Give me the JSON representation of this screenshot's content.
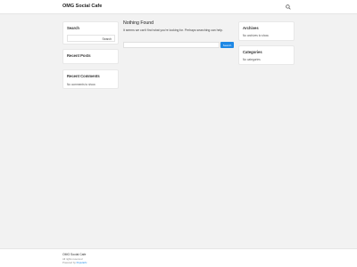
{
  "header": {
    "site_title": "OMG Social Cafe",
    "search_icon": "search-icon"
  },
  "sidebar_left": {
    "search": {
      "title": "Search",
      "button_label": "Search"
    },
    "recent_posts": {
      "title": "Recent Posts"
    },
    "recent_comments": {
      "title": "Recent Comments",
      "empty_text": "No comments to show."
    }
  },
  "main": {
    "title": "Nothing Found",
    "message": "It seems we can't find what you're looking for. Perhaps searching can help.",
    "search_button": "Search"
  },
  "sidebar_right": {
    "archives": {
      "title": "Archives",
      "empty_text": "No archives to show."
    },
    "categories": {
      "title": "Categories",
      "empty_text": "No categories"
    }
  },
  "footer": {
    "site_title": "OMG Social Cafe",
    "rights": "All rights reserved",
    "powered_prefix": "Powered by",
    "powered_link": "Popularfx"
  },
  "colors": {
    "accent": "#1e88e5",
    "background": "#f2f2f2",
    "card": "#ffffff"
  }
}
